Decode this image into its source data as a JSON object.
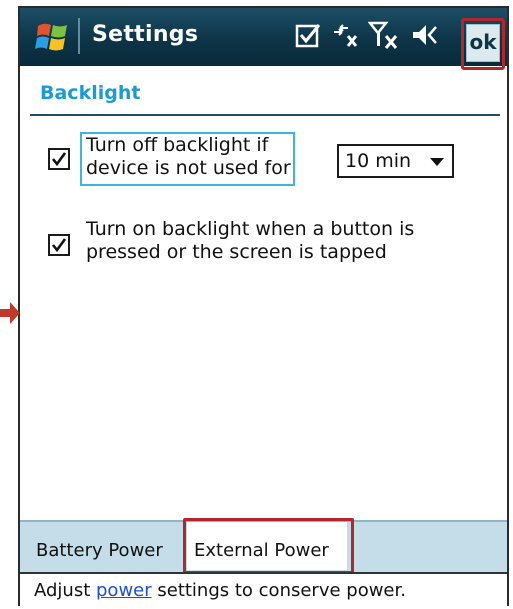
{
  "title_bar": {
    "title": "Settings",
    "ok_label": "ok",
    "icons": [
      "windows-logo-icon",
      "checklist-icon",
      "connectivity-icon",
      "signal-off-icon",
      "speaker-icon"
    ]
  },
  "page": {
    "header": "Backlight"
  },
  "options": [
    {
      "line1": "Turn off backlight if",
      "line2": "device is not used for",
      "checked": true
    },
    {
      "line1": "Turn on backlight when a button is",
      "line2": "pressed or the screen is tapped",
      "checked": true
    }
  ],
  "timeout_select": {
    "value": "10 min"
  },
  "tabs": [
    {
      "label": "Battery Power",
      "active": false
    },
    {
      "label": "External Power",
      "active": true
    }
  ],
  "footer": {
    "prefix": "Adjust ",
    "link": "power",
    "suffix": " settings to conserve power."
  },
  "colors": {
    "title_bar": "#0d3447",
    "header_text": "#1c9bd1",
    "highlight": "#b5262c",
    "tabs_bg": "#c4dde8",
    "link": "#1b4fd1"
  }
}
